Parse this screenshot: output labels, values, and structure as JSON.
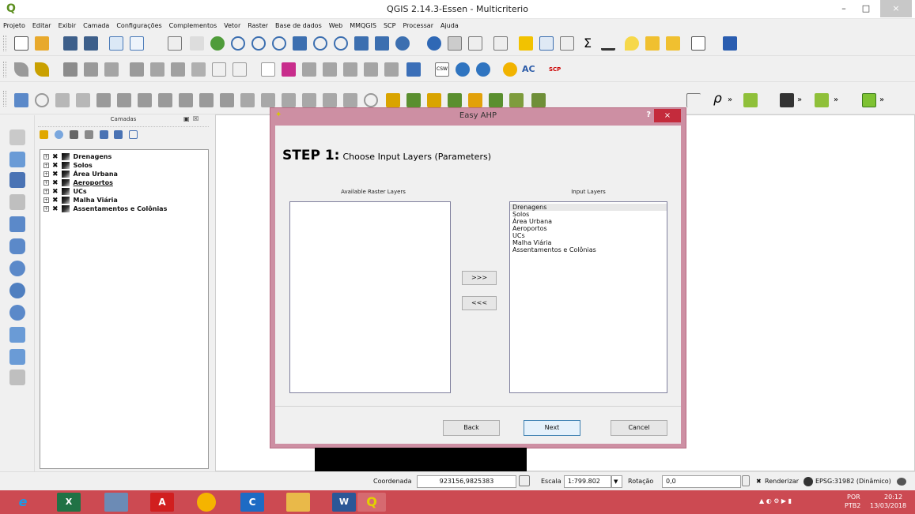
{
  "window": {
    "title": "QGIS 2.14.3-Essen - Multicriterio",
    "minimize": "–",
    "maximize": "□",
    "close": "×"
  },
  "menu": [
    "Projeto",
    "Editar",
    "Exibir",
    "Camada",
    "Configurações",
    "Complementos",
    "Vetor",
    "Raster",
    "Base de dados",
    "Web",
    "MMQGIS",
    "SCP",
    "Processar",
    "Ajuda"
  ],
  "toolbar": {
    "csw_label": "CSW",
    "ac_label": "AC",
    "scp_label": "SCP",
    "rho_label": "ρ",
    "overflow_label": "»"
  },
  "layers_panel": {
    "title": "Camadas",
    "items": [
      {
        "name": "Drenagens",
        "selected": false
      },
      {
        "name": "Solos",
        "selected": false
      },
      {
        "name": "Área Urbana",
        "selected": false
      },
      {
        "name": "Aeroportos",
        "selected": true
      },
      {
        "name": "UCs",
        "selected": false
      },
      {
        "name": "Malha Viária",
        "selected": false
      },
      {
        "name": "Assentamentos e Colônias",
        "selected": false
      }
    ]
  },
  "dialog": {
    "title": "Easy AHP",
    "help": "?",
    "close": "×",
    "step_title": "STEP 1:",
    "step_subtitle": "Choose Input Layers (Parameters)",
    "available_label": "Available Raster Layers",
    "input_label": "Input Layers",
    "available_layers": [],
    "input_layers": [
      "Drenagens",
      "Solos",
      "Área Urbana",
      "Aeroportos",
      "UCs",
      "Malha Viária",
      "Assentamentos e Colônias"
    ],
    "add_button": ">>>",
    "remove_button": "<<<",
    "back_button": "Back",
    "next_button": "Next",
    "cancel_button": "Cancel"
  },
  "statusbar": {
    "coord_label": "Coordenada",
    "coord_value": "923156,9825383",
    "scale_label": "Escala",
    "scale_value": "1:799.802",
    "rotation_label": "Rotação",
    "rotation_value": "0,0",
    "render_label": "Renderizar",
    "crs": "EPSG:31982 (Dinâmico)"
  },
  "taskbar": {
    "lang": "POR",
    "layout": "PTB2",
    "time": "20:12",
    "date": "13/03/2018"
  }
}
